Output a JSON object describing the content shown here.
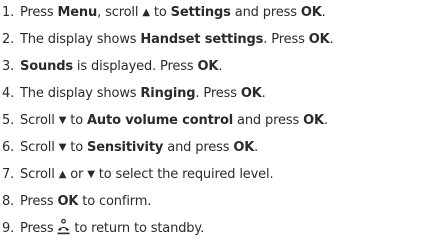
{
  "steps": [
    {
      "number": "1.",
      "parts": [
        {
          "t": "Press "
        },
        {
          "t": "Menu",
          "b": true
        },
        {
          "t": ", scroll "
        },
        {
          "t": "▲",
          "g": "up-arrow-icon"
        },
        {
          "t": " to "
        },
        {
          "t": "Settings",
          "b": true
        },
        {
          "t": " and press "
        },
        {
          "t": "OK",
          "b": true
        },
        {
          "t": "."
        }
      ]
    },
    {
      "number": "2.",
      "parts": [
        {
          "t": "The display shows "
        },
        {
          "t": "Handset settings",
          "b": true
        },
        {
          "t": ". Press "
        },
        {
          "t": "OK",
          "b": true
        },
        {
          "t": "."
        }
      ]
    },
    {
      "number": "3.",
      "parts": [
        {
          "t": "Sounds",
          "b": true
        },
        {
          "t": " is displayed. Press "
        },
        {
          "t": "OK",
          "b": true
        },
        {
          "t": "."
        }
      ]
    },
    {
      "number": "4.",
      "parts": [
        {
          "t": "The display shows "
        },
        {
          "t": "Ringing",
          "b": true
        },
        {
          "t": ". Press "
        },
        {
          "t": "OK",
          "b": true
        },
        {
          "t": "."
        }
      ]
    },
    {
      "number": "5.",
      "parts": [
        {
          "t": "Scroll "
        },
        {
          "t": "▼",
          "g": "down-arrow-icon"
        },
        {
          "t": " to "
        },
        {
          "t": "Auto volume control",
          "b": true
        },
        {
          "t": " and press "
        },
        {
          "t": "OK",
          "b": true
        },
        {
          "t": "."
        }
      ]
    },
    {
      "number": "6.",
      "parts": [
        {
          "t": "Scroll "
        },
        {
          "t": "▼",
          "g": "down-arrow-icon"
        },
        {
          "t": " to "
        },
        {
          "t": "Sensitivity",
          "b": true
        },
        {
          "t": " and press "
        },
        {
          "t": "OK",
          "b": true
        },
        {
          "t": "."
        }
      ]
    },
    {
      "number": "7.",
      "parts": [
        {
          "t": "Scroll "
        },
        {
          "t": "▲",
          "g": "up-arrow-icon"
        },
        {
          "t": " or "
        },
        {
          "t": "▼",
          "g": "down-arrow-icon"
        },
        {
          "t": " to select the required level."
        }
      ]
    },
    {
      "number": "8.",
      "parts": [
        {
          "t": "Press "
        },
        {
          "t": "OK",
          "b": true
        },
        {
          "t": " to confirm."
        }
      ]
    },
    {
      "number": "9.",
      "parts": [
        {
          "t": "Press "
        },
        {
          "icon": "end-call-handset-icon"
        },
        {
          "t": " to return to standby."
        }
      ]
    }
  ]
}
